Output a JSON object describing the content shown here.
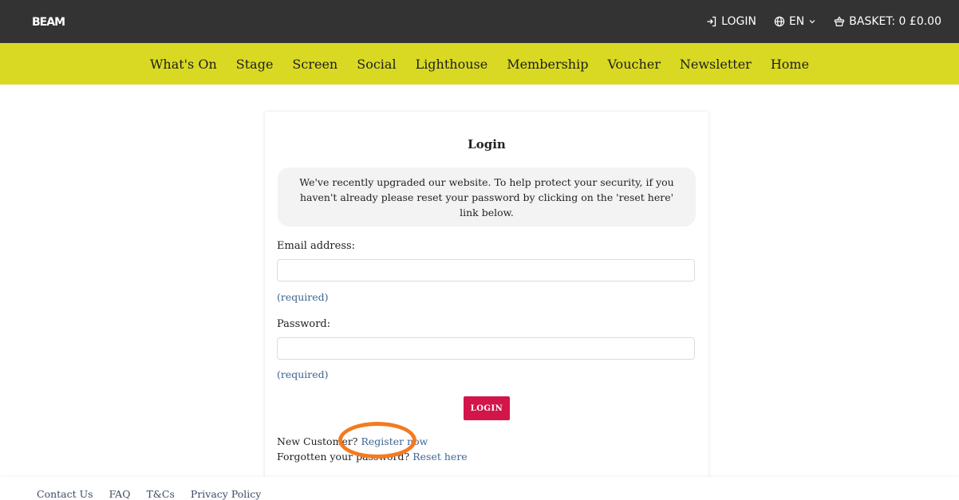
{
  "header": {
    "logo": "BEAM",
    "login_label": "LOGIN",
    "language_label": "EN",
    "basket_label": "BASKET: 0 £0.00"
  },
  "nav": {
    "items": [
      "What's On",
      "Stage",
      "Screen",
      "Social",
      "Lighthouse",
      "Membership",
      "Voucher",
      "Newsletter",
      "Home"
    ]
  },
  "login_form": {
    "title": "Login",
    "notice": "We've recently upgraded our website. To help protect your security, if you haven't already please reset your password by clicking on the 'reset here' link below.",
    "email_label": "Email address:",
    "email_value": "",
    "email_required": "(required)",
    "password_label": "Password:",
    "password_value": "",
    "password_required": "(required)",
    "submit_label": "LOGIN",
    "new_customer_text": "New Customer?",
    "register_link": "Register now",
    "forgot_text": "Forgotten your password?",
    "reset_link": "Reset here"
  },
  "footer": {
    "links": [
      "Contact Us",
      "FAQ",
      "T&Cs",
      "Privacy Policy"
    ]
  },
  "colors": {
    "topbar": "#333333",
    "navbar": "#d9d923",
    "login_button": "#d3164a",
    "link": "#3d6591",
    "highlight_ring": "#f57a1f"
  },
  "icons": {
    "login": "login-arrow-icon",
    "language": "globe-icon",
    "language_toggle": "chevron-down-icon",
    "basket": "basket-icon"
  }
}
